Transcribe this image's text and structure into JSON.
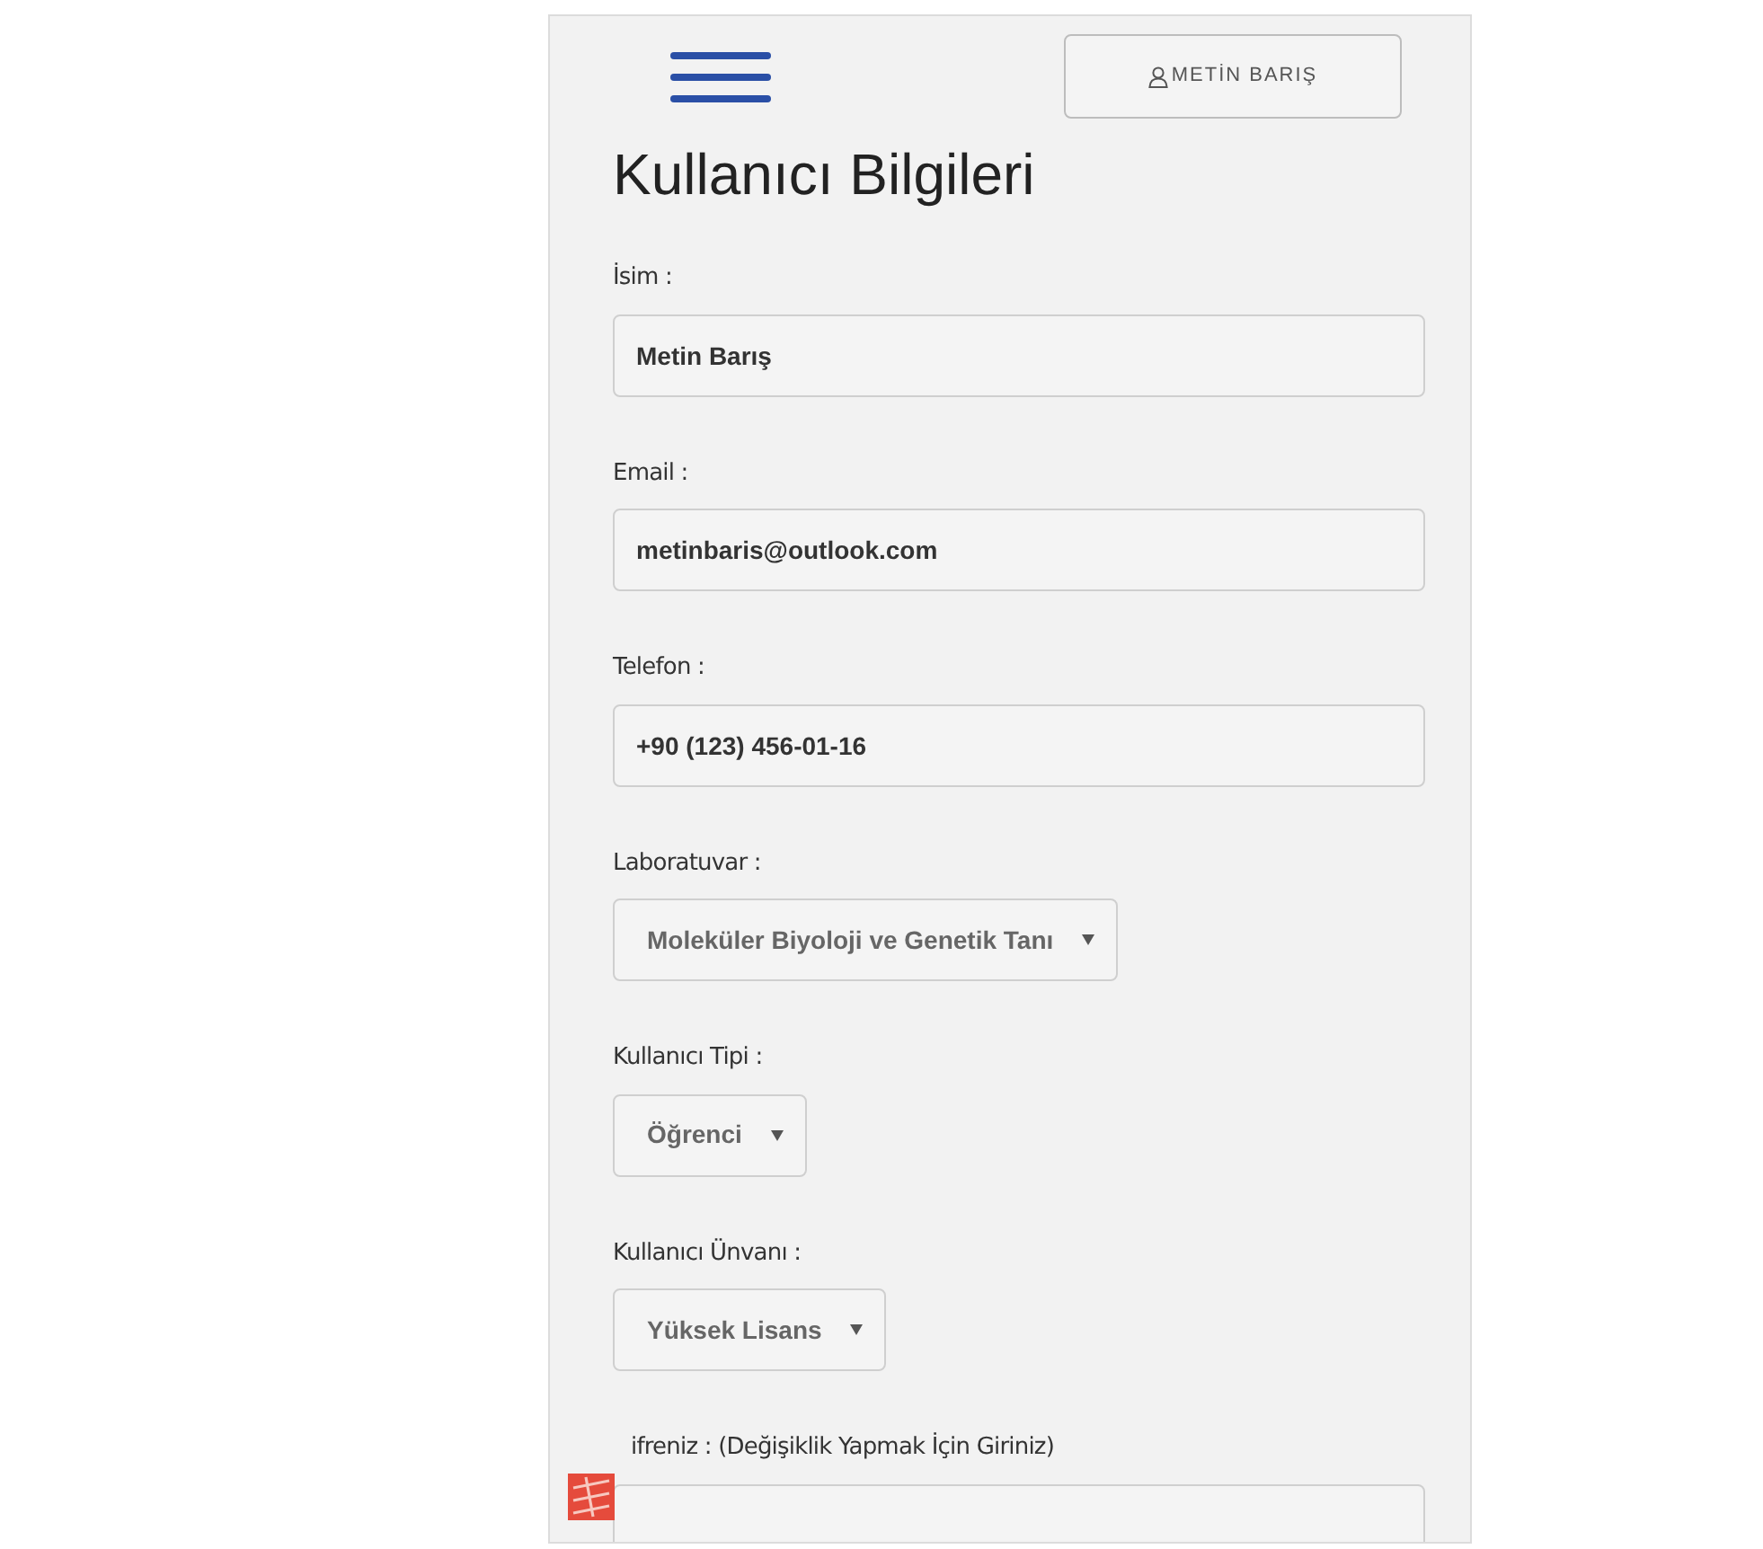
{
  "header": {
    "user_button": "METİN BARIŞ"
  },
  "title": "Kullanıcı Bilgileri",
  "fields": [
    {
      "kind": "text",
      "label": "İsim :",
      "value": "Metin Barış"
    },
    {
      "kind": "text",
      "label": "Email :",
      "value": "metinbaris@outlook.com"
    },
    {
      "kind": "text",
      "label": "Telefon :",
      "value": "+90 (123) 456-01-16"
    },
    {
      "kind": "select",
      "label": "Laboratuvar :",
      "value": "Moleküler Biyoloji ve Genetik Tanı"
    },
    {
      "kind": "select",
      "label": "Kullanıcı Tipi :",
      "value": "Öğrenci"
    },
    {
      "kind": "select",
      "label": "Kullanıcı Ünvanı :",
      "value": "Yüksek Lisans"
    },
    {
      "kind": "password",
      "label": "ifreniz : (Değişiklik Yapmak İçin Giriniz)"
    }
  ]
}
